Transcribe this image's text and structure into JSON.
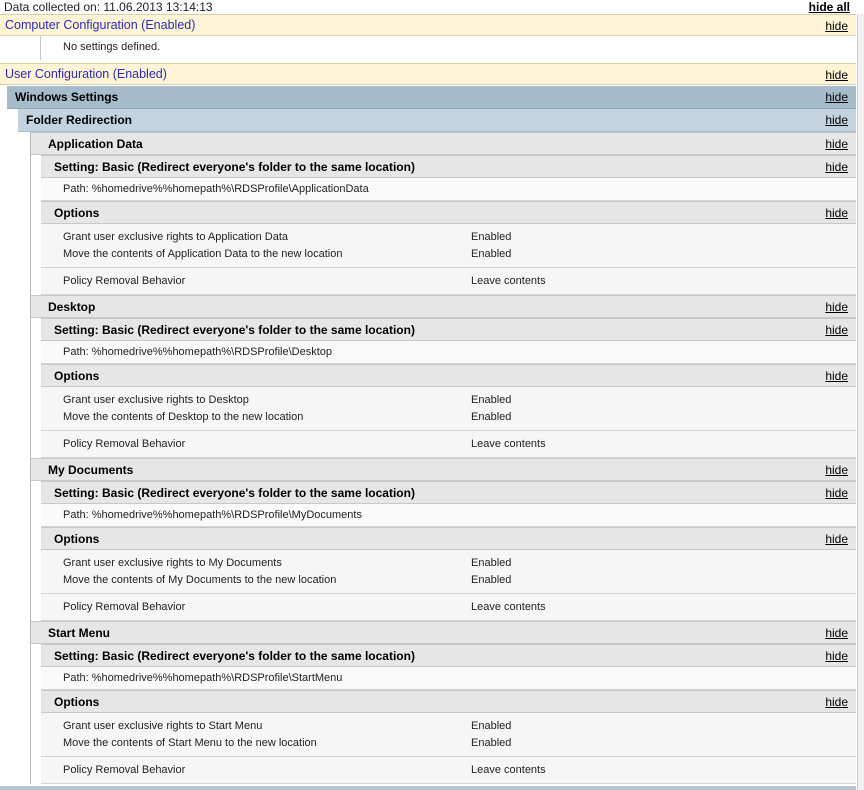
{
  "header": {
    "collected": "Data collected on: 11.06.2013 13:14:13",
    "hide_all": "hide all"
  },
  "hide_label": "hide",
  "computer_config": {
    "title": "Computer Configuration (Enabled)",
    "message": "No settings defined."
  },
  "user_config": {
    "title": "User Configuration (Enabled)",
    "windows_settings": "Windows Settings",
    "folder_redirection": "Folder Redirection",
    "setting_title": "Setting: Basic (Redirect everyone's folder to the same location)",
    "options_title": "Options",
    "removal_label": "Policy Removal Behavior",
    "removal_value": "Leave contents",
    "enabled": "Enabled",
    "folders": [
      {
        "name": "Application Data",
        "path": "Path: %homedrive%%homepath%\\RDSProfile\\ApplicationData",
        "grant": "Grant user exclusive rights to Application Data",
        "move": "Move the contents of Application Data to the new location"
      },
      {
        "name": "Desktop",
        "path": "Path: %homedrive%%homepath%\\RDSProfile\\Desktop",
        "grant": "Grant user exclusive rights to Desktop",
        "move": "Move the contents of Desktop to the new location"
      },
      {
        "name": "My Documents",
        "path": "Path: %homedrive%%homepath%\\RDSProfile\\MyDocuments",
        "grant": "Grant user exclusive rights to My Documents",
        "move": "Move the contents of My Documents to the new location"
      },
      {
        "name": "Start Menu",
        "path": "Path: %homedrive%%homepath%\\RDSProfile\\StartMenu",
        "grant": "Grant user exclusive rights to Start Menu",
        "move": "Move the contents of Start Menu to the new location"
      }
    ]
  }
}
